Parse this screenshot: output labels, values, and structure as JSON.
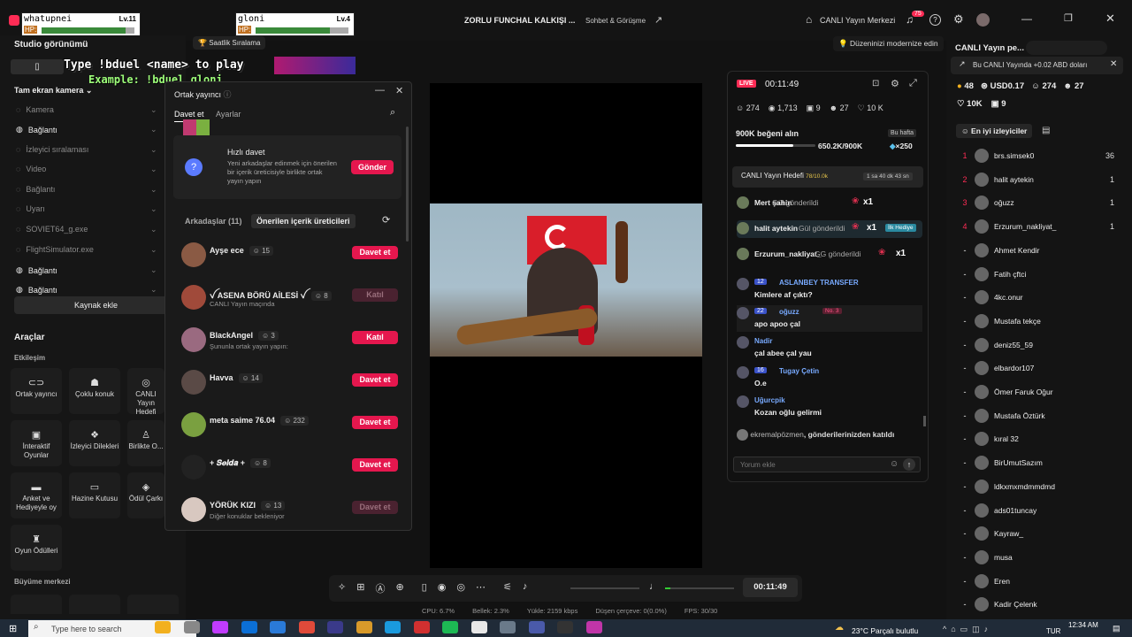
{
  "titlebar": {
    "title": "ZORLU FUNCHAL KALKIŞI ...",
    "subtitle": "Sohbet & Görüşme",
    "live_center": "CANLI Yayın Merkezi",
    "notif_count": "75"
  },
  "overlay": {
    "p1_name": "whatupnei",
    "p1_lv": "Lv.11",
    "p1_hp": "HP:",
    "p2_name": "gloni",
    "p2_lv": "Lv.4",
    "p2_hp": "HP:",
    "banner1": "Type !bduel <name> to play",
    "banner2": "Example: !bduel gloni",
    "saatlik": "Saatlik Sıralama",
    "modernize": "Düzeninizi modernize edin"
  },
  "sidebar": {
    "studio": "Studio görünümü",
    "tam_ekran": "Tam ekran kamera",
    "items": [
      {
        "label": "Kamera",
        "on": false
      },
      {
        "label": "Bağlantı",
        "on": true
      },
      {
        "label": "İzleyici sıralaması",
        "on": false
      },
      {
        "label": "Video",
        "on": false
      },
      {
        "label": "Bağlantı",
        "on": false
      },
      {
        "label": "Uyarı",
        "on": false
      },
      {
        "label": "SOVIET64_g.exe",
        "on": false
      },
      {
        "label": "FlightSimulator.exe",
        "on": false
      },
      {
        "label": "Bağlantı",
        "on": true
      },
      {
        "label": "Bağlantı",
        "on": true
      }
    ],
    "kaynak_ekle": "Kaynak ekle",
    "araclar": "Araçlar",
    "etkilesim": "Etkileşim",
    "buyume": "Büyüme merkezi",
    "tools": [
      {
        "label": "Ortak yayıncı",
        "icon": "⊂⊃"
      },
      {
        "label": "Çoklu konuk",
        "icon": "☗"
      },
      {
        "label": "CANLI Yayın Hedefi",
        "icon": "◎"
      },
      {
        "label": "İnteraktif Oyunlar",
        "icon": "▣"
      },
      {
        "label": "İzleyici Dilekleri",
        "icon": "❖"
      },
      {
        "label": "Birlikte O...",
        "icon": "♙"
      },
      {
        "label": "Anket ve Hediyeyle oy",
        "icon": "▬"
      },
      {
        "label": "Hazine Kutusu",
        "icon": "▭"
      },
      {
        "label": "Ödül Çarkı",
        "icon": "◈"
      },
      {
        "label": "Oyun Ödülleri",
        "icon": "♜"
      }
    ]
  },
  "cohost": {
    "title": "Ortak yayıncı",
    "tab_invite": "Davet et",
    "tab_settings": "Ayarlar",
    "quick_title": "Hızlı davet",
    "quick_desc": "Yeni arkadaşlar edinmek için önerilen bir içerik üreticisiyle birlikte ortak yayın yapın",
    "quick_btn": "Gönder",
    "friends_tab": "Arkadaşlar (11)",
    "suggested_tab": "Önerilen içerik üreticileri",
    "friends": [
      {
        "name": "Ayşe ece",
        "count": "15",
        "sub": "",
        "action": "Davet et",
        "enabled": true,
        "color": "#8a5a44"
      },
      {
        "name": "ꪜ ASENA BÖRÜ AİLESİ ꪜ",
        "count": "8",
        "sub": "CANLI Yayın maçında",
        "action": "Katıl",
        "enabled": false,
        "color": "#a04a3a"
      },
      {
        "name": "BlackAngel",
        "count": "3",
        "sub": "Şununla ortak yayın yapın:",
        "action": "Katıl",
        "enabled": true,
        "color": "#9a6a80"
      },
      {
        "name": "Havva",
        "count": "14",
        "sub": "",
        "action": "Davet et",
        "enabled": true,
        "color": "#5a4a46"
      },
      {
        "name": "meta saime 76.04",
        "count": "232",
        "sub": "",
        "action": "Davet et",
        "enabled": true,
        "color": "#7aa040"
      },
      {
        "name": "+ 𝑺𝒆𝒍𝒅𝒂 +",
        "count": "8",
        "sub": "",
        "action": "Davet et",
        "enabled": true,
        "color": "#222"
      },
      {
        "name": "YÖRÜK KIZI",
        "count": "13",
        "sub": "Diğer konuklar bekleniyor",
        "action": "Davet et",
        "enabled": false,
        "color": "#d8c8c0"
      }
    ]
  },
  "live": {
    "badge": "LIVE",
    "timer": "00:11:49",
    "viewers": "274",
    "views": "1,713",
    "gifts": "9",
    "follows": "27",
    "likes": "10 K",
    "goal_title": "900K beğeni alın",
    "goal_week": "Bu hafta",
    "goal_value": "650.2K/900K",
    "goal_progress": 0.72,
    "goal_reward": "×250",
    "target_label": "CANLI Yayın Hedefi",
    "target_val": "78/10.0k",
    "target_time": "1 sa 40 dk 43 sn",
    "gifts_list": [
      {
        "user": "Mert şahin",
        "text": "Gül gönderildi",
        "mult": "x1"
      },
      {
        "user": "halit aytekin",
        "text": "Gül gönderildi",
        "mult": "x1",
        "tag": "İlk Hediye"
      },
      {
        "user": "Erzurum_nakliyat_",
        "text": "GG gönderildi",
        "mult": "x1"
      }
    ],
    "chat": [
      {
        "badge": "12",
        "user": "ASLANBEY TRANSFER",
        "msg": "Kimlere af çıktı?"
      },
      {
        "badge": "22",
        "user": "oğuzz",
        "tag": "No. 3",
        "msg": "apo apoo çal"
      },
      {
        "badge": "",
        "user": "Nadir",
        "msg": "çal abee çal yau"
      },
      {
        "badge": "16",
        "user": "Tugay Çetin",
        "msg": "O.e"
      },
      {
        "badge": "",
        "user": "Uğurcpik",
        "msg": "Kozan oğlu gelirmi"
      }
    ],
    "joined_user": "ekremalpözmen",
    "joined_text": ", gönderilerinizden katıldı",
    "comment_placeholder": "Yorum ekle"
  },
  "right": {
    "title": "CANLI Yayın pe...",
    "promo": "Bu CANLI Yayında +0.02 ABD doları",
    "coins": "48",
    "usd": "USD0.17",
    "viewers": "274",
    "follows": "27",
    "likes": "10K",
    "gifts": "9",
    "top_viewers": "En iyi izleyiciler",
    "ranking": [
      {
        "r": "1",
        "name": "brs.simsek0",
        "v": "36"
      },
      {
        "r": "2",
        "name": "halit aytekin",
        "v": "1"
      },
      {
        "r": "3",
        "name": "oğuzz",
        "v": "1"
      },
      {
        "r": "4",
        "name": "Erzurum_nakliyat_",
        "v": "1"
      },
      {
        "r": "",
        "name": "Ahmet Kendir",
        "v": ""
      },
      {
        "r": "",
        "name": "Fatih çftci",
        "v": ""
      },
      {
        "r": "",
        "name": "4kc.onur",
        "v": ""
      },
      {
        "r": "",
        "name": "Mustafa tekçe",
        "v": ""
      },
      {
        "r": "",
        "name": "deniz55_59",
        "v": ""
      },
      {
        "r": "",
        "name": "elbardor107",
        "v": ""
      },
      {
        "r": "",
        "name": "Ömer Faruk Oğur",
        "v": ""
      },
      {
        "r": "",
        "name": "Mustafa Öztürk",
        "v": ""
      },
      {
        "r": "",
        "name": "kıral 32",
        "v": ""
      },
      {
        "r": "",
        "name": "BirUmutSazım",
        "v": ""
      },
      {
        "r": "",
        "name": "ldkxmxmdmmdmd",
        "v": ""
      },
      {
        "r": "",
        "name": "ads01tuncay",
        "v": ""
      },
      {
        "r": "",
        "name": "Kayraw_",
        "v": ""
      },
      {
        "r": "",
        "name": "musa",
        "v": ""
      },
      {
        "r": "",
        "name": "Eren",
        "v": ""
      },
      {
        "r": "",
        "name": "Kadir Çelenk",
        "v": ""
      }
    ]
  },
  "controls": {
    "timer": "00:11:49"
  },
  "status": {
    "cpu": "CPU: 6.7%",
    "mem": "Bellek: 2.3%",
    "upload": "Yükle: 2159 kbps",
    "dropped": "Düşen çerçeve: 0(0.0%)",
    "fps": "FPS: 30/30"
  },
  "taskbar": {
    "search": "Type here to search",
    "weather": "23°C Parçalı bulutlu",
    "lang": "TUR",
    "time": "12:34 AM"
  },
  "colors": {
    "accent": "#e5174e",
    "live": "#fe2c55",
    "blue": "#5b7bff"
  }
}
